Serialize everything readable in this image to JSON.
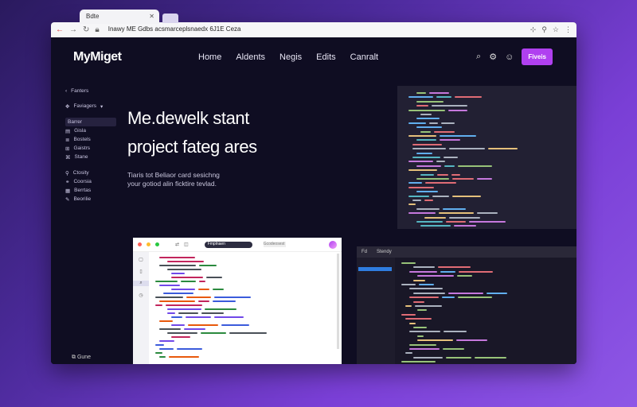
{
  "browser": {
    "tab_title": "Bdte",
    "url": "Inawy ME Gdbs acsmarceplsnaedx 6J1E Ceza"
  },
  "header": {
    "logo": "MyMiget",
    "nav": [
      "Home",
      "Aldents",
      "Negis",
      "Edits",
      "Canralt"
    ],
    "cta_label": "Fiveis"
  },
  "sidebar": {
    "top_item": "Fanters",
    "group_label": "Faviagers",
    "items": [
      "Barrer",
      "Gisla",
      "Bostels",
      "Gaistrs",
      "Stane",
      "Ctosity",
      "Coorsia",
      "Berrtas",
      "Beorilie"
    ],
    "footer": "Gune"
  },
  "hero": {
    "title_line1": "Me.dewelk stant",
    "title_line2": "project fateg ares",
    "subtitle_line1": "Tiaris tot Beliaor card sesichng",
    "subtitle_line2": "your gotiod alin ficktire tevlad."
  },
  "editor_light": {
    "tab": "Fmplnaen",
    "search": "Gcodeosest"
  },
  "editor_dark": {
    "header_left": "Fd",
    "header_tab": "Stendy"
  },
  "colors": {
    "accent": "#b040f0",
    "page_bg": "#0f0d22"
  }
}
